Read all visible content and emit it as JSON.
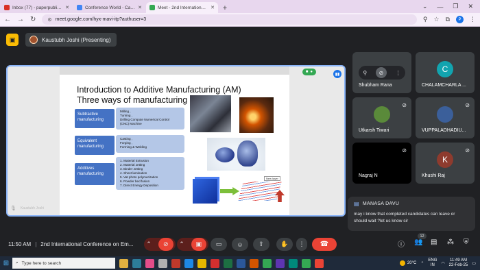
{
  "browser": {
    "tabs": [
      {
        "label": "Inbox (77) - paperpublication20",
        "color": "#d93025",
        "active": false
      },
      {
        "label": "Conference World - Calendar",
        "color": "#4285f4",
        "active": false
      },
      {
        "label": "Meet - 2nd International Co",
        "color": "#34a853",
        "active": true
      }
    ],
    "new_tab": "+",
    "url": "meet.google.com/hyx-mavi-itp?authuser=3",
    "profile_initial": "P"
  },
  "meet_header": {
    "presenter": "Kaustubh Joshi (Presenting)"
  },
  "slide": {
    "title": "Introduction to Additive Manufacturing (AM)",
    "subtitle": "Three ways of manufacturing",
    "boxes": [
      {
        "label": "Subtractive manufacturing",
        "items": [
          "Milling ,",
          "Turning ,",
          "Drilling Compute Numerical Control",
          "(CNC) Machine"
        ]
      },
      {
        "label": "Equivalent manufacturing",
        "items": [
          "Casting ,",
          "Forging ,",
          "Forming & Welding"
        ]
      },
      {
        "label": "Additives manufacturing",
        "items": [
          "1. Material Extrusion",
          "2. Material Jetting",
          "3. Binder Jetting",
          "4. Sheet lamination",
          "5. Vat photo polymerization",
          "6. Powder bed fusion",
          "7. Direct Energy Deposition"
        ]
      }
    ],
    "new_layer_label": "New layer",
    "footer": "Kaustubh Joshi"
  },
  "participants": [
    {
      "name": "Shubham Rana",
      "initial": "",
      "avatar_color": "#3c4043"
    },
    {
      "name": "CHALAMCHARLA ...",
      "initial": "C",
      "avatar_color": "#12a4af"
    },
    {
      "name": "Utkarsh Tiwari",
      "initial": "",
      "avatar_color": "#5a8a3a"
    },
    {
      "name": "VUPPALADHADIU...",
      "initial": "",
      "avatar_color": "#3b5f9a"
    },
    {
      "name": "Nagraj N",
      "initial": "",
      "avatar_color": "#000000"
    },
    {
      "name": "Khushi Raj",
      "initial": "K",
      "avatar_color": "#8e3b2e"
    }
  ],
  "chat": {
    "sender": "MANASA DAVU",
    "message": "may i know that completed candidates can leave or should wait ?let us know sir"
  },
  "callbar": {
    "time": "11:50 AM",
    "meeting_title": "2nd International Conference on Em...",
    "people_count": "12"
  },
  "taskbar": {
    "search_placeholder": "Type here to search",
    "temperature": "20°C",
    "lang": "ENG",
    "region": "IN",
    "time": "11:49 AM",
    "date": "22-Feb-25"
  },
  "colors": {
    "meet_bg": "#202124",
    "accent": "#8ab4f8",
    "end_call": "#ea4335",
    "slide_box": "#4472c4",
    "slide_detail": "#b4c7e7"
  }
}
